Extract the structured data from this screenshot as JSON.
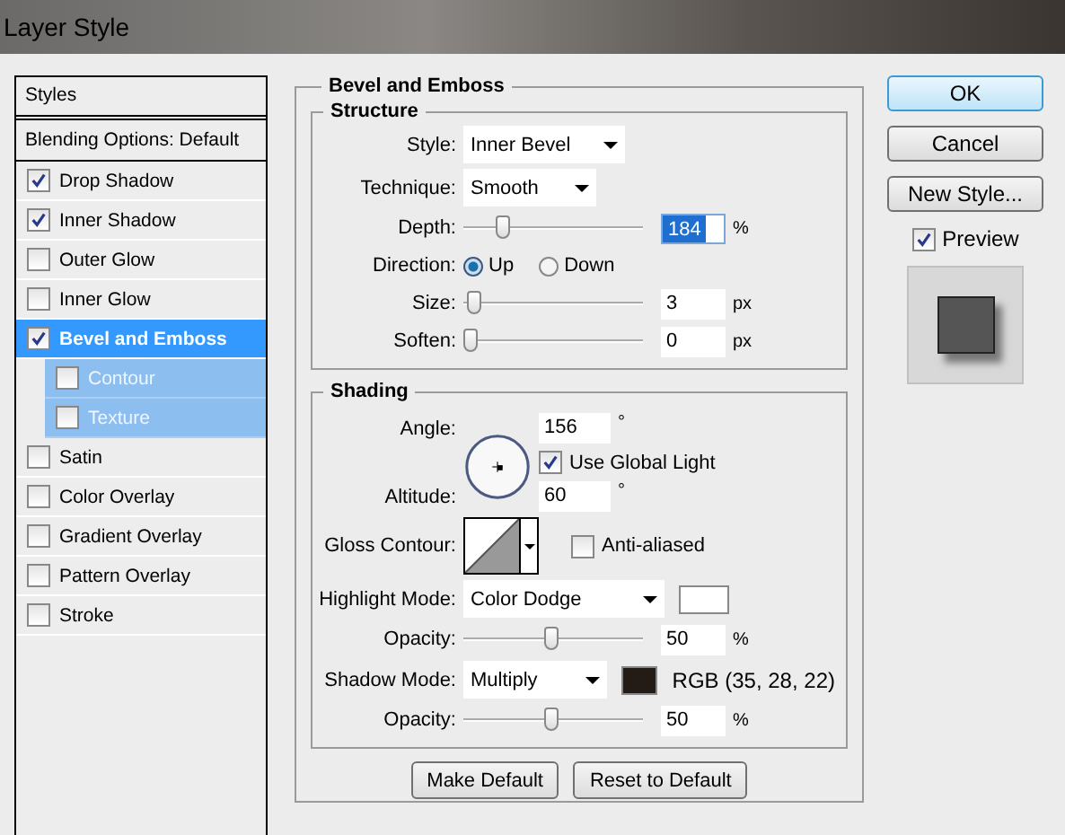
{
  "window": {
    "title": "Layer Style"
  },
  "styles_panel": {
    "header": "Styles",
    "blending_options": "Blending Options: Default",
    "items": [
      {
        "label": "Drop Shadow",
        "checked": true,
        "selected": false
      },
      {
        "label": "Inner Shadow",
        "checked": true,
        "selected": false
      },
      {
        "label": "Outer Glow",
        "checked": false,
        "selected": false
      },
      {
        "label": "Inner Glow",
        "checked": false,
        "selected": false
      },
      {
        "label": "Bevel and Emboss",
        "checked": true,
        "selected": true,
        "children": [
          {
            "label": "Contour",
            "checked": false,
            "selected": false
          },
          {
            "label": "Texture",
            "checked": false,
            "selected": false
          }
        ]
      },
      {
        "label": "Satin",
        "checked": false,
        "selected": false
      },
      {
        "label": "Color Overlay",
        "checked": false,
        "selected": false
      },
      {
        "label": "Gradient Overlay",
        "checked": false,
        "selected": false
      },
      {
        "label": "Pattern Overlay",
        "checked": false,
        "selected": false
      },
      {
        "label": "Stroke",
        "checked": false,
        "selected": false
      }
    ]
  },
  "bevel_panel": {
    "title": "Bevel and Emboss",
    "structure": {
      "title": "Structure",
      "style": {
        "label": "Style:",
        "value": "Inner Bevel"
      },
      "technique": {
        "label": "Technique:",
        "value": "Smooth"
      },
      "depth": {
        "label": "Depth:",
        "level": 0.2,
        "value": "184",
        "value_selected": true,
        "unit": "%"
      },
      "direction": {
        "label": "Direction:",
        "options": [
          {
            "label": "Up",
            "selected": true
          },
          {
            "label": "Down",
            "selected": false
          }
        ]
      },
      "size": {
        "label": "Size:",
        "level": 0.02,
        "value": "3",
        "value_selected": false,
        "unit": "px"
      },
      "soften": {
        "label": "Soften:",
        "level": 0,
        "value": "0",
        "value_selected": false,
        "unit": "px"
      }
    },
    "shading": {
      "title": "Shading",
      "angle": {
        "label": "Angle:",
        "value": "156",
        "unit": "°"
      },
      "use_global_light": {
        "label": "Use Global Light",
        "checked": true
      },
      "altitude": {
        "label": "Altitude:",
        "value": "60",
        "unit": "°"
      },
      "gloss_contour": {
        "label": "Gloss Contour:"
      },
      "anti_aliased": {
        "label": "Anti-aliased",
        "checked": false
      },
      "highlight_mode": {
        "label": "Highlight Mode:",
        "value": "Color Dodge",
        "color": "#ffffff"
      },
      "highlight_opacity": {
        "label": "Opacity:",
        "level": 0.5,
        "value": "50",
        "value_selected": false,
        "unit": "%"
      },
      "shadow_mode": {
        "label": "Shadow Mode:",
        "value": "Multiply",
        "color": "#231c16",
        "color_note": "RGB (35, 28, 22)"
      },
      "shadow_opacity": {
        "label": "Opacity:",
        "level": 0.5,
        "value": "50",
        "value_selected": false,
        "unit": "%"
      }
    },
    "buttons": [
      "Make Default",
      "Reset to Default"
    ]
  },
  "actions": {
    "ok": "OK",
    "cancel": "Cancel",
    "new_style": "New Style...",
    "preview": {
      "label": "Preview",
      "checked": true
    }
  }
}
